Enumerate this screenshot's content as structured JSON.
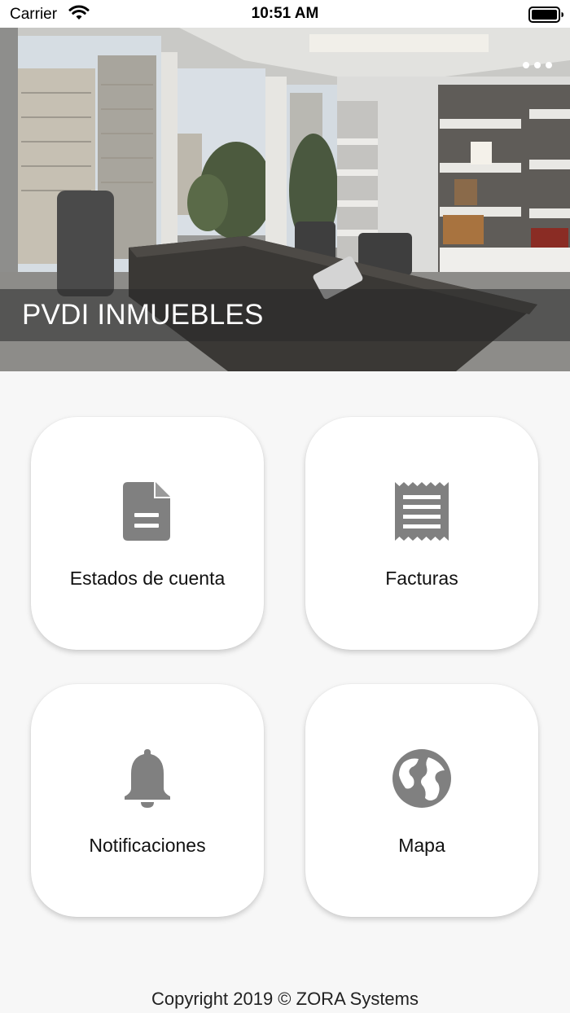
{
  "status_bar": {
    "carrier": "Carrier",
    "time": "10:51 AM"
  },
  "hero": {
    "title": "PVDI INMUEBLES",
    "image_icon": "office-photo"
  },
  "tiles": [
    {
      "label": "Estados de cuenta",
      "icon": "document-icon"
    },
    {
      "label": "Facturas",
      "icon": "receipt-icon"
    },
    {
      "label": "Notificaciones",
      "icon": "bell-icon"
    },
    {
      "label": "Mapa",
      "icon": "globe-icon"
    }
  ],
  "footer": {
    "copyright": "Copyright 2019 © ZORA Systems"
  },
  "colors": {
    "icon": "#808080",
    "tile_bg": "#ffffff",
    "page_bg": "#f7f7f7"
  }
}
